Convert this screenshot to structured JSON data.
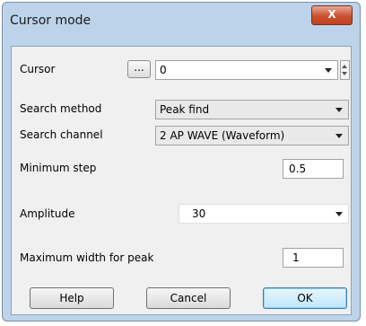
{
  "window": {
    "title": "Cursor mode",
    "close_label": "X"
  },
  "form": {
    "cursor": {
      "label": "Cursor",
      "dots_label": "...",
      "value": "0"
    },
    "search_method": {
      "label": "Search method",
      "value": "Peak find"
    },
    "search_channel": {
      "label": "Search channel",
      "value": "2 AP WAVE (Waveform)"
    },
    "minimum_step": {
      "label": "Minimum step",
      "value": "0.5"
    },
    "amplitude": {
      "label": "Amplitude",
      "value": "30"
    },
    "max_width": {
      "label": "Maximum width for peak",
      "value": "1"
    }
  },
  "buttons": {
    "help": "Help",
    "cancel": "Cancel",
    "ok": "OK"
  }
}
